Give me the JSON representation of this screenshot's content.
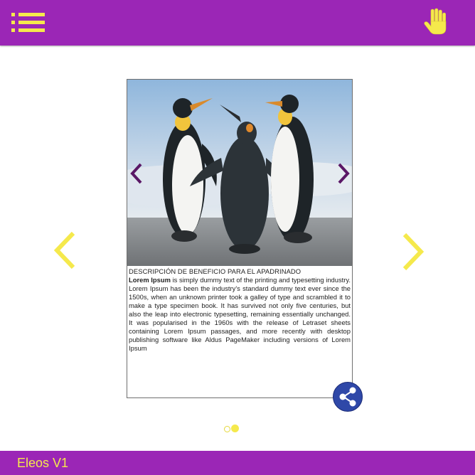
{
  "header": {
    "menu_icon": "list-menu-icon",
    "hand_icon": "hand-icon",
    "accent": "#9b26b6",
    "icon_color": "#f5e94c"
  },
  "carousel": {
    "prev_icon": "chevron-left-icon",
    "next_icon": "chevron-right-icon",
    "card": {
      "image_icon": "penguins-photo",
      "inner_prev_icon": "chevron-left-icon",
      "inner_next_icon": "chevron-right-icon",
      "title": "DESCRIPCIÓN DE BENEFICIO PARA EL APADRINADO",
      "lead": "Lorem Ipsum",
      "body": " is simply dummy text of the printing and typesetting industry. Lorem Ipsum has been the industry's standard dummy text ever since the 1500s, when an unknown printer took a galley of type and scrambled it to make a type specimen book. It has survived not only five centuries, but also the leap into electronic typesetting, remaining essentially unchanged. It was popularised in the 1960s with the release of Letraset sheets containing Lorem Ipsum passages, and more recently with desktop publishing software like Aldus PageMaker including versions of Lorem Ipsum"
    },
    "share_icon": "share-icon",
    "pagination": {
      "total": 2,
      "active": 2
    }
  },
  "footer": {
    "app_name": "Eleos V1"
  }
}
